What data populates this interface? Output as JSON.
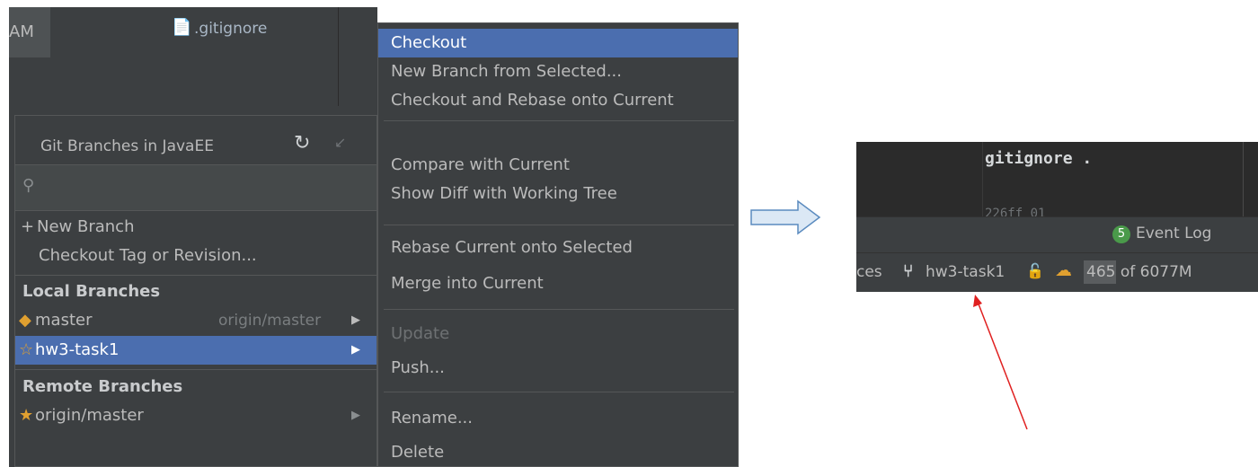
{
  "left_bg": {
    "tab_fragment": "AM",
    "gitignore_tab": ".gitignore"
  },
  "branches_popup": {
    "title": "Git Branches in JavaEE",
    "search_placeholder": "",
    "new_branch": "New Branch",
    "checkout_tag": "Checkout Tag or Revision...",
    "local_header": "Local Branches",
    "local_branches": [
      {
        "name": "master",
        "tracking": "origin/master",
        "icon": "tag-icon",
        "selected": false
      },
      {
        "name": "hw3-task1",
        "tracking": "",
        "icon": "star-outline-icon",
        "selected": true
      }
    ],
    "remote_header": "Remote Branches",
    "remote_branches": [
      {
        "name": "origin/master",
        "icon": "star-filled-icon"
      }
    ]
  },
  "context_menu": {
    "items": [
      {
        "label": "Checkout",
        "state": "active"
      },
      {
        "label": "New Branch from Selected...",
        "state": "normal"
      },
      {
        "label": "Checkout and Rebase onto Current",
        "state": "normal"
      },
      {
        "label": "Compare with Current",
        "state": "normal"
      },
      {
        "label": "Show Diff with Working Tree",
        "state": "normal"
      },
      {
        "label": "Rebase Current onto Selected",
        "state": "normal"
      },
      {
        "label": "Merge into Current",
        "state": "normal"
      },
      {
        "label": "Update",
        "state": "disabled"
      },
      {
        "label": "Push...",
        "state": "normal"
      },
      {
        "label": "Rename...",
        "state": "normal"
      },
      {
        "label": "Delete",
        "state": "normal"
      }
    ]
  },
  "right_crop": {
    "code_line": "gitignore .",
    "code_partial": "226ff 01",
    "event_count": "5",
    "event_label": "Event Log",
    "status_prefix": "ces",
    "branch": "hw3-task1",
    "memory_used": "465",
    "memory_total": " of 6077M"
  },
  "colors": {
    "ide_bg": "#3c3f41",
    "selection": "#4b6eaf",
    "annotation_arrow": "#e02020",
    "connector_fill": "#dbe8f5",
    "connector_stroke": "#5b8bbf"
  }
}
